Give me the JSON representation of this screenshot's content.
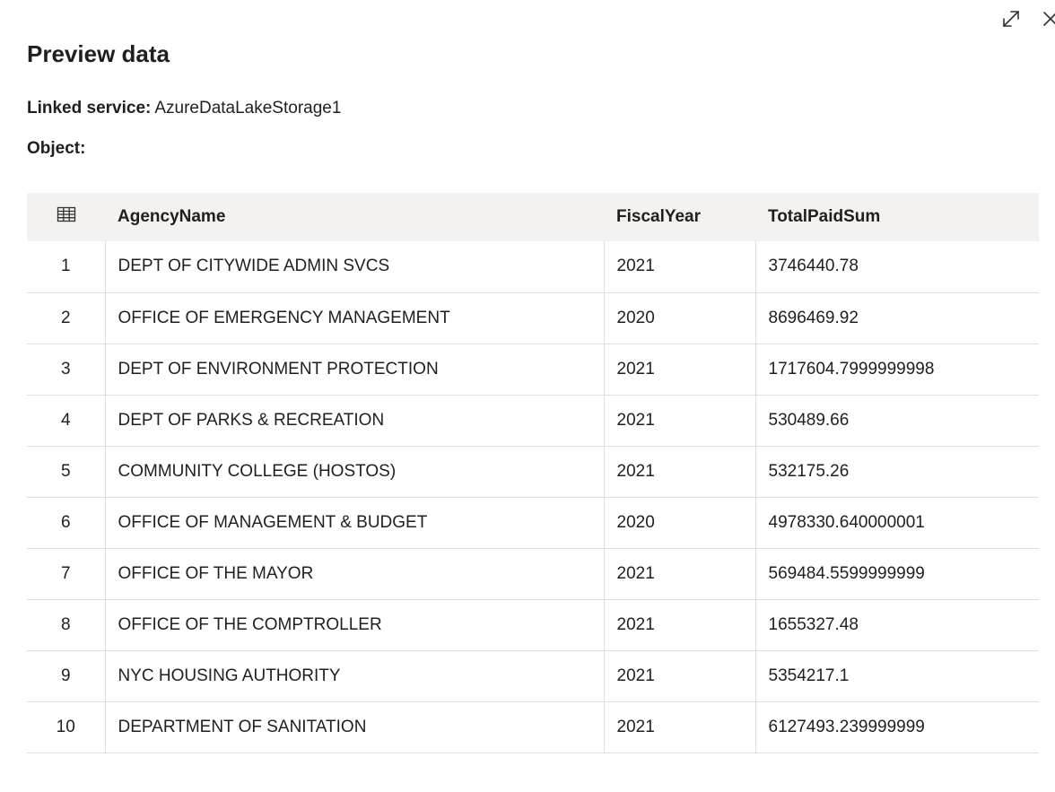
{
  "header": {
    "title": "Preview data",
    "expand_icon": "expand-icon",
    "close_icon": "close-icon"
  },
  "meta": {
    "linked_service_label": "Linked service:",
    "linked_service_value": "AzureDataLakeStorage1",
    "object_label": "Object:",
    "object_value": ""
  },
  "table": {
    "grid_icon": "table-grid-icon",
    "columns": [
      "AgencyName",
      "FiscalYear",
      "TotalPaidSum"
    ],
    "rows": [
      {
        "index": "1",
        "agency": "DEPT OF CITYWIDE ADMIN SVCS",
        "year": "2021",
        "total": "3746440.78"
      },
      {
        "index": "2",
        "agency": "OFFICE OF EMERGENCY MANAGEMENT",
        "year": "2020",
        "total": "8696469.92"
      },
      {
        "index": "3",
        "agency": "DEPT OF ENVIRONMENT PROTECTION",
        "year": "2021",
        "total": "1717604.7999999998"
      },
      {
        "index": "4",
        "agency": "DEPT OF PARKS & RECREATION",
        "year": "2021",
        "total": "530489.66"
      },
      {
        "index": "5",
        "agency": "COMMUNITY COLLEGE (HOSTOS)",
        "year": "2021",
        "total": "532175.26"
      },
      {
        "index": "6",
        "agency": "OFFICE OF MANAGEMENT & BUDGET",
        "year": "2020",
        "total": "4978330.640000001"
      },
      {
        "index": "7",
        "agency": "OFFICE OF THE MAYOR",
        "year": "2021",
        "total": "569484.5599999999"
      },
      {
        "index": "8",
        "agency": "OFFICE OF THE COMPTROLLER",
        "year": "2021",
        "total": "1655327.48"
      },
      {
        "index": "9",
        "agency": "NYC HOUSING AUTHORITY",
        "year": "2021",
        "total": "5354217.1"
      },
      {
        "index": "10",
        "agency": "DEPARTMENT OF SANITATION",
        "year": "2021",
        "total": "6127493.239999999"
      }
    ]
  }
}
